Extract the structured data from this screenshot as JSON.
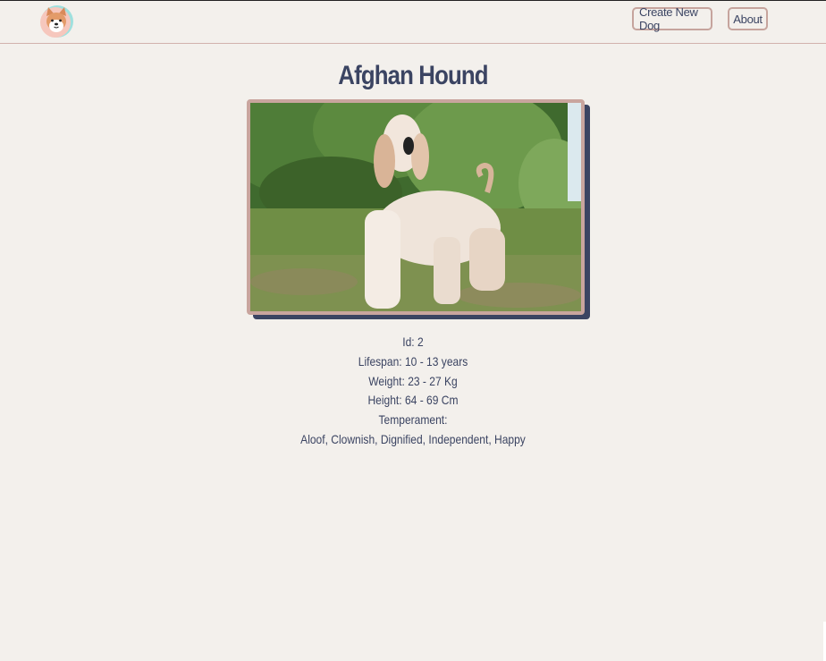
{
  "header": {
    "logo_icon": "dog-face-icon",
    "nav": [
      {
        "label": "Create New Dog"
      },
      {
        "label": "About"
      }
    ]
  },
  "dog": {
    "name": "Afghan Hound",
    "image_alt": "Afghan Hound photo",
    "details": [
      {
        "label": "Id:",
        "value": "2"
      },
      {
        "label": "Lifespan:",
        "value": "10 - 13 years"
      },
      {
        "label": "Weight:",
        "value": "23 - 27 Kg"
      },
      {
        "label": "Height:",
        "value": "64 - 69 Cm"
      },
      {
        "label": "Temperament:",
        "value": ""
      }
    ],
    "temperament": "Aloof, Clownish, Dignified, Independent, Happy"
  },
  "colors": {
    "background": "#f3f0ec",
    "text": "#3b4462",
    "accent_border": "#c9a59e",
    "shadow": "#3b4462"
  }
}
